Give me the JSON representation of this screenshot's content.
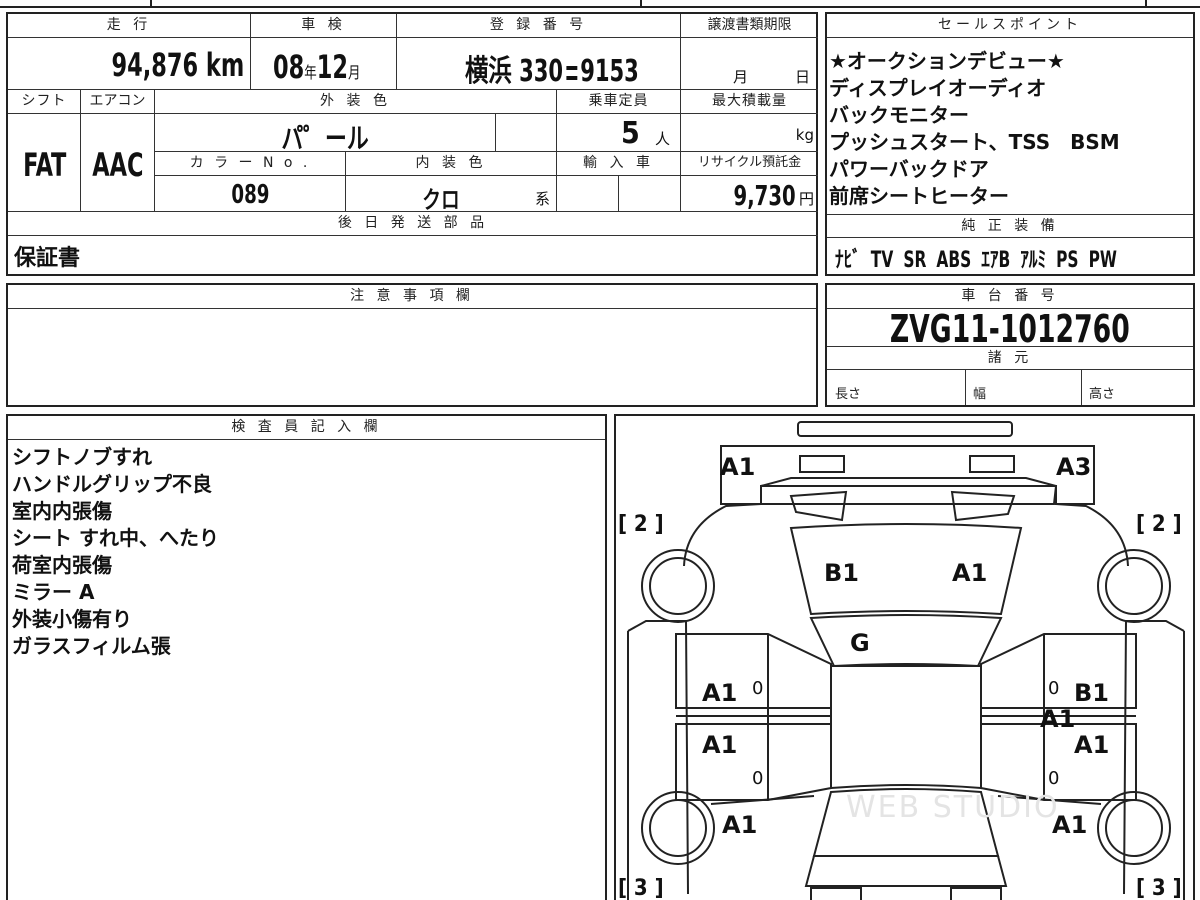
{
  "vehicle": {
    "mileage_label": "走 行",
    "mileage_value": "94,876",
    "mileage_unit": "km",
    "inspection_label": "車 検",
    "inspection_year": "08",
    "inspection_year_unit": "年",
    "inspection_month": "12",
    "inspection_month_unit": "月",
    "registration_label": "登 録 番 号",
    "registration_value": "横浜 330",
    "registration_number": "9153",
    "transfer_label": "譲渡書類期限",
    "transfer_month_unit": "月",
    "transfer_day_unit": "日",
    "shift_label": "シフト",
    "shift_value": "FAT",
    "ac_label": "エアコン",
    "ac_value": "AAC",
    "exterior_color_label": "外 装 色",
    "exterior_color_value": "パ゜ール",
    "capacity_label": "乗車定員",
    "capacity_value": "5",
    "capacity_unit": "人",
    "max_load_label": "最大積載量",
    "max_load_unit": "kg",
    "color_no_label": "カ ラ ー N o .",
    "color_no_value": "089",
    "interior_label": "内 装 色",
    "interior_value": "クロ",
    "interior_suffix": "系",
    "import_label": "輸 入 車",
    "recycle_label": "リサイクル預託金",
    "recycle_value": "9,730",
    "recycle_unit": "円"
  },
  "later_parts": {
    "label": "後 日 発 送 部 品",
    "value": "保証書"
  },
  "sales_points": {
    "label": "セールスポイント",
    "items": [
      "★オークションデビュー★",
      "ディスプレイオーディオ",
      "バックモニター",
      "プッシュスタート、TSS　BSM",
      "パワーバックドア",
      "前席シートヒーター"
    ]
  },
  "equipment": {
    "label": "純 正 装 備",
    "items": [
      "ﾅﾋﾞ",
      "TV",
      "SR",
      "ABS",
      "ｴｱB",
      "ｱﾙﾐ",
      "PS",
      "PW"
    ]
  },
  "caution": {
    "label": "注 意 事 項 欄"
  },
  "chassis": {
    "label": "車 台 番 号",
    "value": "ZVG11-1012760"
  },
  "specs": {
    "label": "諸 元",
    "length_label": "長さ",
    "width_label": "幅",
    "height_label": "高さ"
  },
  "inspector": {
    "label": "検 査 員 記 入 欄",
    "notes": [
      "シフトノブすれ",
      "ハンドルグリップ不良",
      "室内内張傷",
      "シート すれ中、へたり",
      "荷室内張傷",
      "ミラー A",
      "外装小傷有り",
      "ガラスフィルム張"
    ]
  },
  "diagram": {
    "marks": {
      "front_left": "A1",
      "front_right": "A3",
      "hood_left": "B1",
      "hood_right": "A1",
      "windshield": "G",
      "door_fl": "A1",
      "door_rl": "A1",
      "door_fr_a": "B1",
      "door_fr_b": "A1",
      "door_rr": "A1",
      "rear_left": "A1",
      "rear_right": "A1",
      "zero_a": "0",
      "zero_b": "0",
      "zero_c": "0",
      "zero_d": "0"
    },
    "tire_front_left": "[ 2 ]",
    "tire_front_right": "[ 2 ]",
    "tire_rear_left": "[ 3 ]",
    "tire_rear_right": "[ 3 ]",
    "watermark": "WEB STUDIO"
  }
}
